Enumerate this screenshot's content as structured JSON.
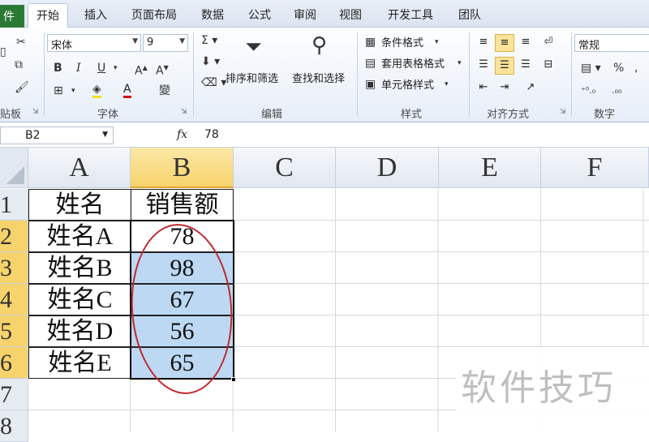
{
  "ribbon_tabs": [
    "件",
    "开始",
    "插入",
    "页面布局",
    "数据",
    "公式",
    "审阅",
    "视图",
    "开发工具",
    "团队"
  ],
  "font": {
    "name": "宋体",
    "size": "9"
  },
  "number_format": "常规",
  "buttons": {
    "sort_filter": "排序和筛选",
    "find_select": "查找和选择",
    "conditional_format": "条件格式",
    "table_format": "套用表格格式",
    "cell_style": "单元格样式"
  },
  "group_labels": {
    "clipboard": "贴板",
    "font": "字体",
    "edit": "编辑",
    "style": "样式",
    "alignment": "对齐方式",
    "number": "数字"
  },
  "formula_bar": {
    "name_box": "B2",
    "fx": "fx",
    "value": "78"
  },
  "columns": [
    "A",
    "B",
    "C",
    "D",
    "E",
    "F"
  ],
  "rows": [
    "1",
    "2",
    "3",
    "4",
    "5",
    "6",
    "7",
    "8"
  ],
  "table": {
    "headers": [
      "姓名",
      "销售额"
    ],
    "data": [
      [
        "姓名A",
        "78"
      ],
      [
        "姓名B",
        "98"
      ],
      [
        "姓名C",
        "67"
      ],
      [
        "姓名D",
        "56"
      ],
      [
        "姓名E",
        "65"
      ]
    ]
  },
  "watermark": "软件技巧",
  "colors": {
    "file_tab": "#2a7a36",
    "selection": "#bcd8f3",
    "header_highlight": "#f7d36b",
    "annotation": "#c0282d"
  }
}
